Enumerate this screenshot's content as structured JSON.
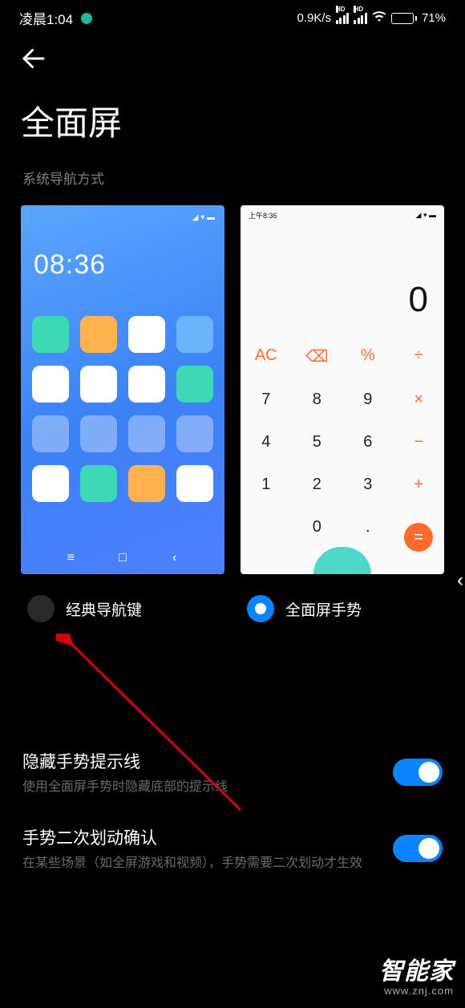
{
  "status": {
    "time": "凌晨1:04",
    "speed": "0.9K/s",
    "hd_label": "HD",
    "battery": "71%"
  },
  "page": {
    "title": "全面屏",
    "section_label": "系统导航方式"
  },
  "preview_home": {
    "clock": "08:36"
  },
  "preview_calc": {
    "status_time": "上午8:36",
    "display": "0",
    "keys_row1": [
      "AC",
      "⌫",
      "%",
      "÷"
    ],
    "keys_row2": [
      "7",
      "8",
      "9",
      "×"
    ],
    "keys_row3": [
      "4",
      "5",
      "6",
      "−"
    ],
    "keys_row4": [
      "1",
      "2",
      "3",
      "+"
    ],
    "keys_row5": [
      "",
      "0",
      ".",
      "="
    ]
  },
  "options": {
    "classic": {
      "label": "经典导航键",
      "selected": false
    },
    "gesture": {
      "label": "全面屏手势",
      "selected": true
    }
  },
  "settings": {
    "hide_hint": {
      "title": "隐藏手势提示线",
      "desc": "使用全面屏手势时隐藏底部的提示线",
      "on": true
    },
    "double_swipe": {
      "title": "手势二次划动确认",
      "desc": "在某些场景（如全屏游戏和视频），手势需要二次划动才生效",
      "on": true
    }
  },
  "watermark": {
    "brand": "智能家",
    "url": "www.znj.com"
  }
}
